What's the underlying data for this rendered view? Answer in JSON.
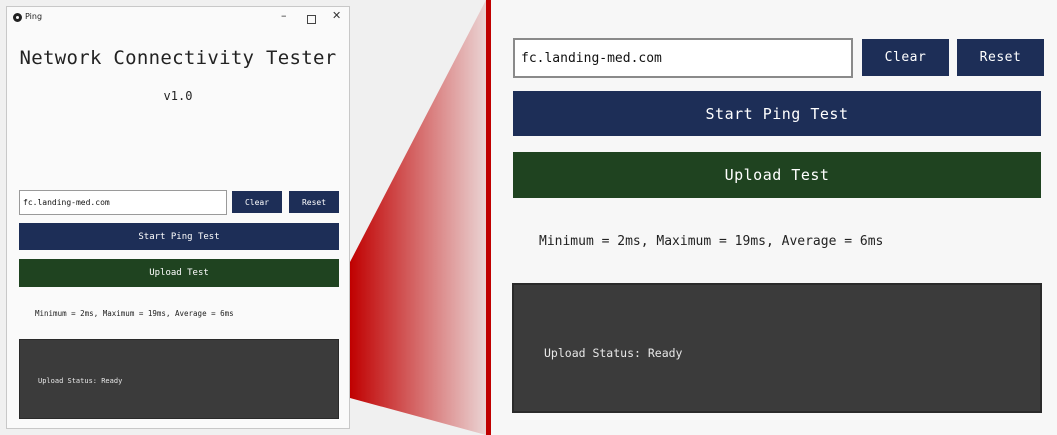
{
  "window": {
    "title": "Ping",
    "controls": {
      "minimize_icon": "minimize-icon",
      "maximize_icon": "maximize-icon",
      "close_icon": "close-icon"
    }
  },
  "header": {
    "title": "Network Connectivity Tester",
    "version": "v1.0"
  },
  "host_input": {
    "value": "fc.landing-med.com"
  },
  "buttons": {
    "clear": "Clear",
    "reset": "Reset",
    "start_ping": "Start Ping Test",
    "upload": "Upload Test"
  },
  "stats": "Minimum = 2ms, Maximum = 19ms, Average = 6ms",
  "upload_status": "Upload Status: Ready",
  "colors": {
    "primary_button": "#1d2e57",
    "upload_button": "#1f4320",
    "status_panel": "#3b3b3b",
    "zoom_highlight": "#c00000"
  }
}
